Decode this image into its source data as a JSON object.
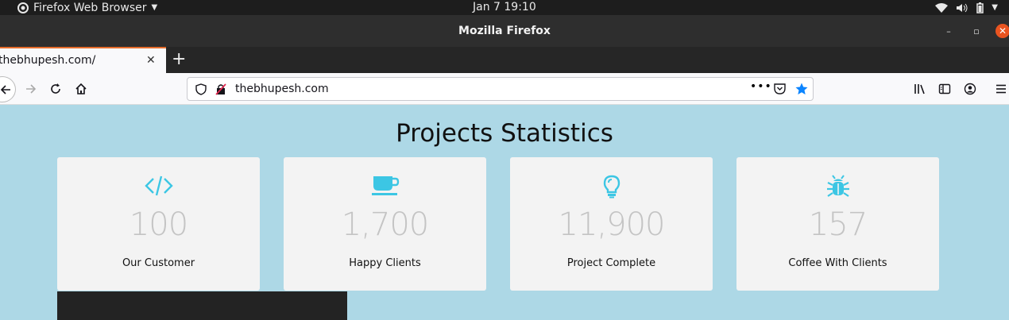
{
  "system": {
    "app_name": "Firefox Web Browser",
    "clock": "Jan 7  19:10"
  },
  "window": {
    "title": "Mozilla Firefox"
  },
  "tabs": [
    {
      "title": "thebhupesh.com/"
    }
  ],
  "navbar": {
    "url": "thebhupesh.com"
  },
  "page": {
    "heading": "Projects Statistics",
    "accent_color": "#3cc6e4",
    "count_color": "#c4c4c4",
    "background": "#add8e6",
    "stats": [
      {
        "icon": "code-icon",
        "count": "100",
        "label": "Our Customer"
      },
      {
        "icon": "coffee-cup-icon",
        "count": "1,700",
        "label": "Happy Clients"
      },
      {
        "icon": "lightbulb-icon",
        "count": "11,900",
        "label": "Project Complete"
      },
      {
        "icon": "bug-icon",
        "count": "157",
        "label": "Coffee With Clients"
      }
    ]
  }
}
